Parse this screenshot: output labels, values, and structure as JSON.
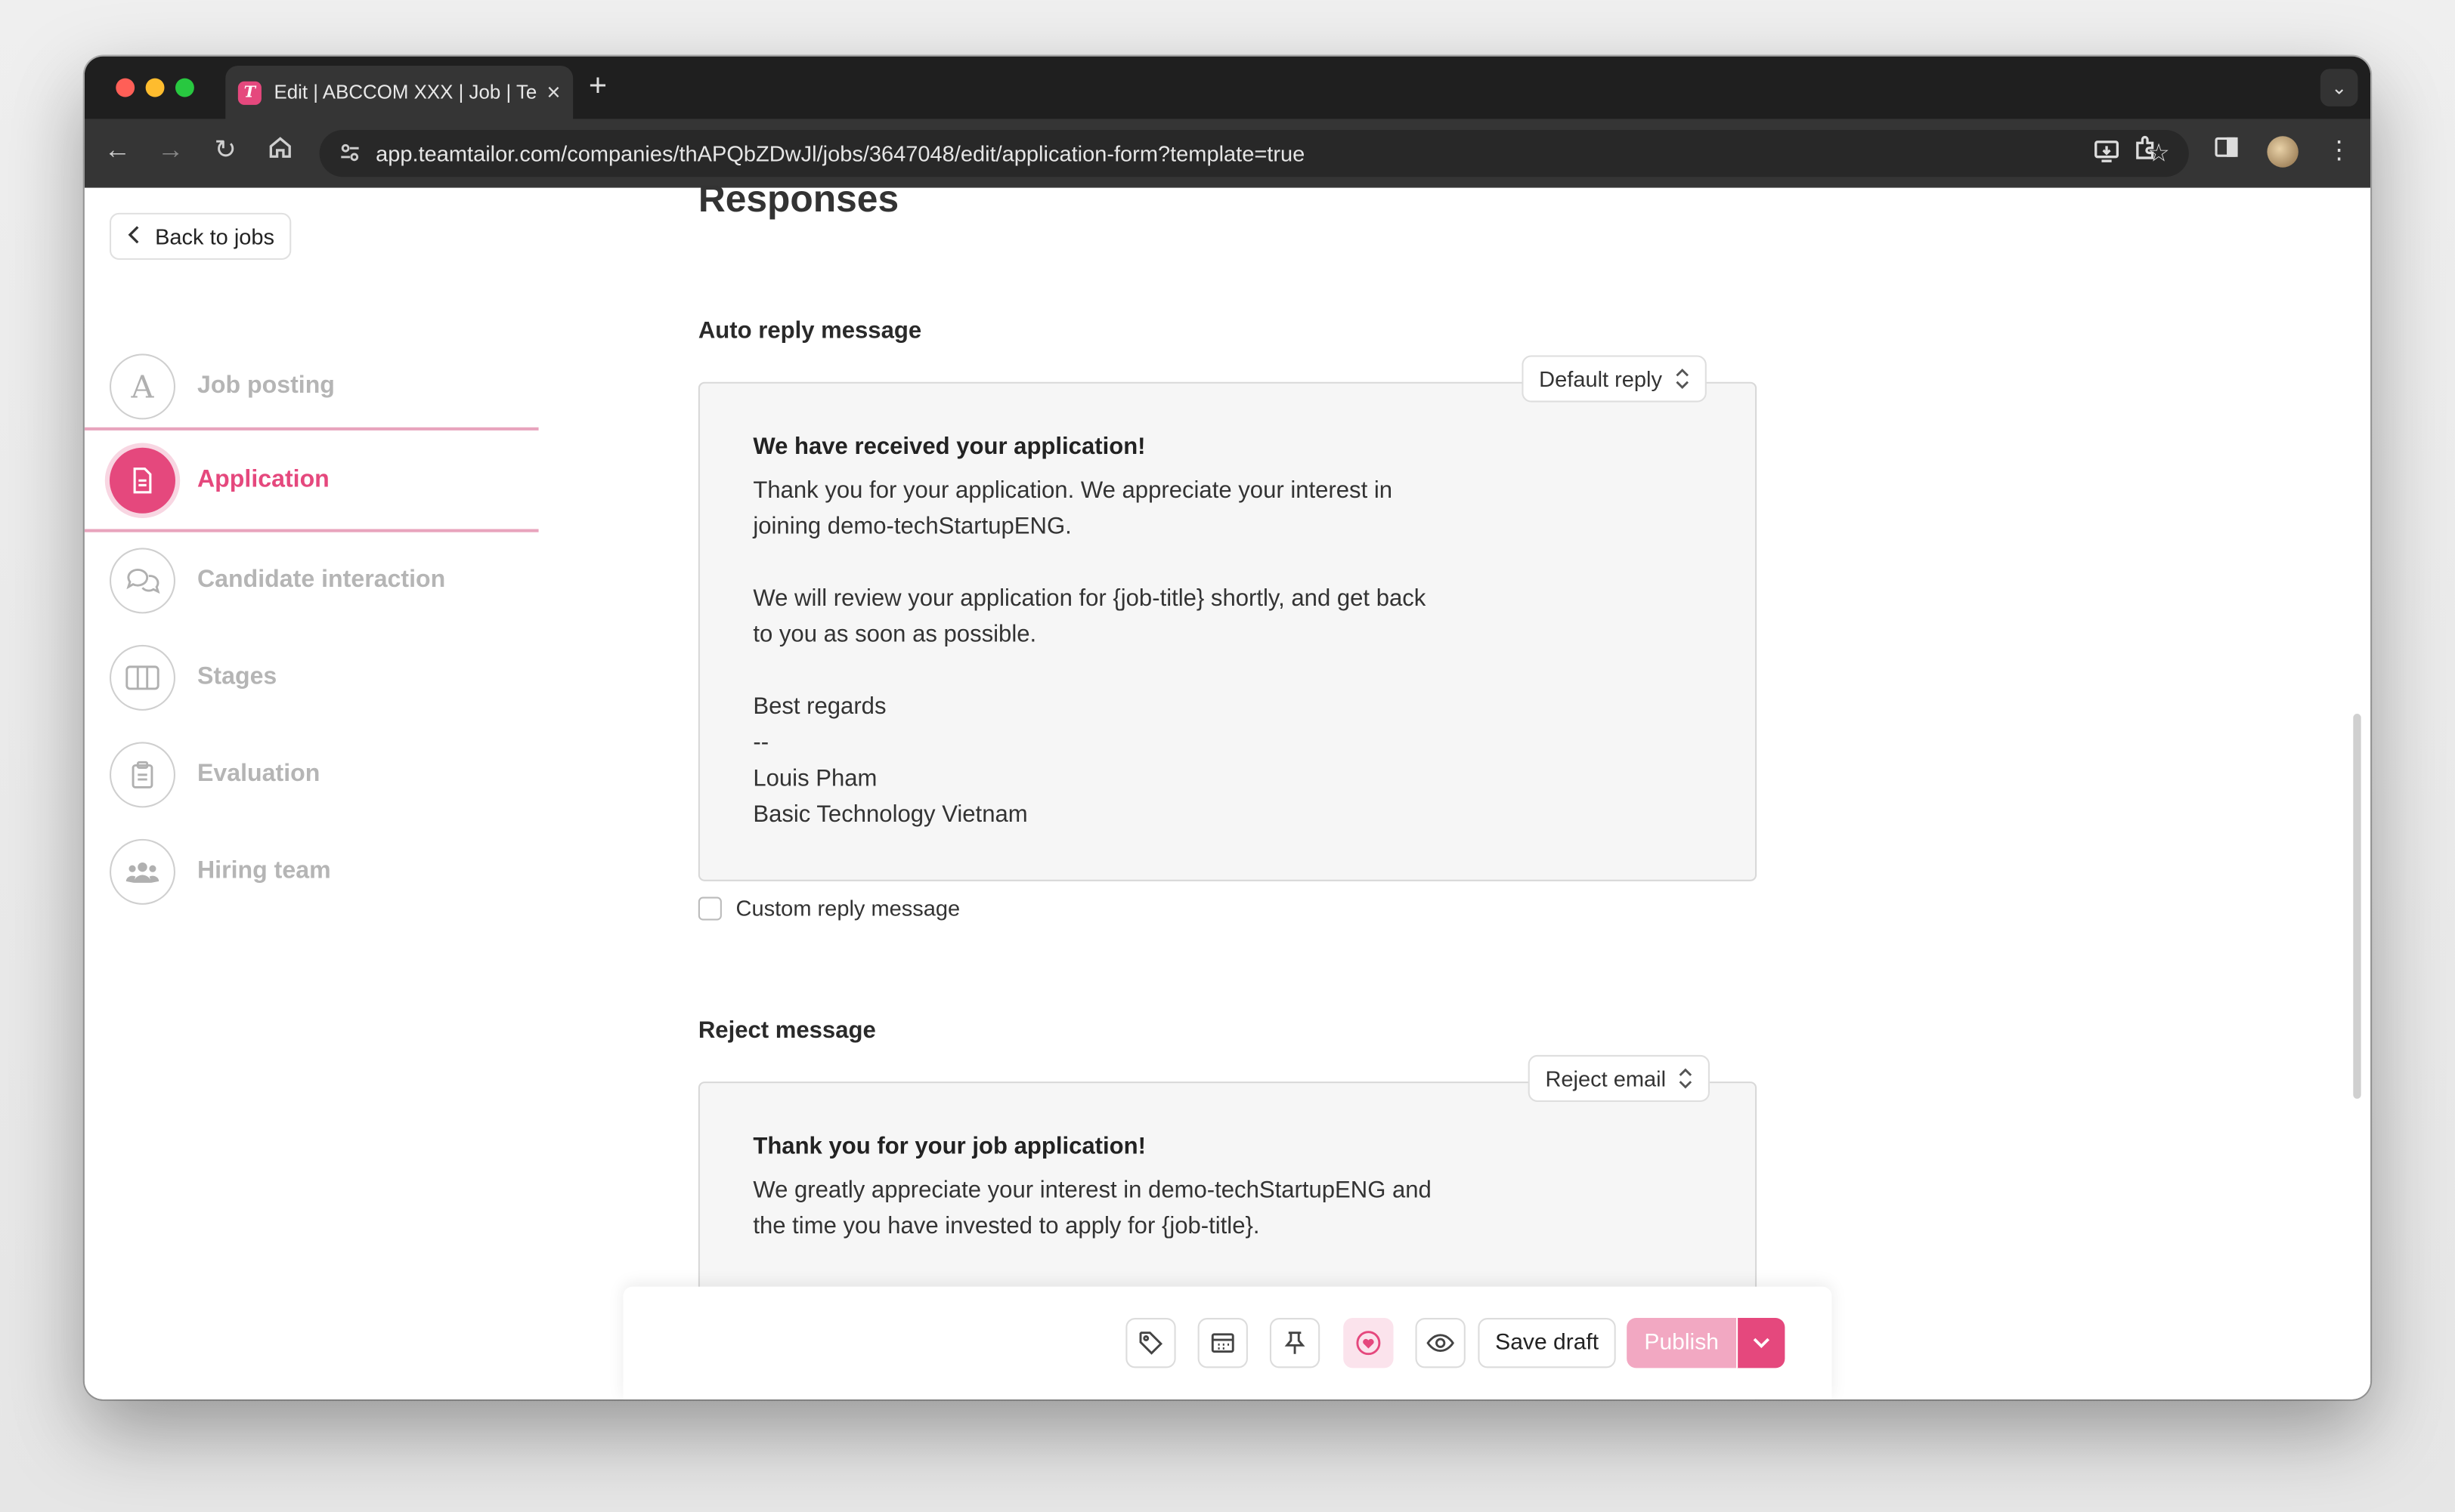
{
  "browser": {
    "tab_title": "Edit | ABCCOM XXX | Job | Te",
    "favicon_letter": "T",
    "url": "app.teamtailor.com/companies/thAPQbZDwJl/jobs/3647048/edit/application-form?template=true"
  },
  "sidebar": {
    "back_label": "Back to jobs",
    "items": [
      {
        "label": "Job posting",
        "icon": "letter-a-icon",
        "glyph": "A",
        "active": false
      },
      {
        "label": "Application",
        "icon": "document-icon",
        "active": true
      },
      {
        "label": "Candidate interaction",
        "icon": "chat-bubbles-icon",
        "active": false
      },
      {
        "label": "Stages",
        "icon": "columns-icon",
        "active": false
      },
      {
        "label": "Evaluation",
        "icon": "clipboard-icon",
        "active": false
      },
      {
        "label": "Hiring team",
        "icon": "people-icon",
        "active": false
      }
    ]
  },
  "main": {
    "heading": "Responses",
    "auto_reply": {
      "label": "Auto reply message",
      "dropdown": "Default reply",
      "title": "We have received your application!",
      "body": "Thank you for your application. We appreciate your interest in\njoining demo-techStartupENG.\n\nWe will review your application for {job-title} shortly, and get back\nto you as soon as possible.\n\nBest regards\n--\nLouis Pham\nBasic Technology Vietnam",
      "custom_checkbox_label": "Custom reply message",
      "custom_checked": false
    },
    "reject": {
      "label": "Reject message",
      "dropdown": "Reject email",
      "title": "Thank you for your job application!",
      "body": "We greatly appreciate your interest in demo-techStartupENG and\nthe time you have invested to apply for {job-title}.\n\nWe have reviewed your application, and unfortunately we are not\nable to offer you a position at this time."
    }
  },
  "bottom_bar": {
    "icons": [
      "tag-icon",
      "calendar-icon",
      "pin-icon",
      "heart-icon",
      "eye-icon"
    ],
    "save_draft": "Save draft",
    "publish": "Publish"
  },
  "colors": {
    "accent": "#e5487d",
    "accent_light": "#f2a8c2"
  }
}
